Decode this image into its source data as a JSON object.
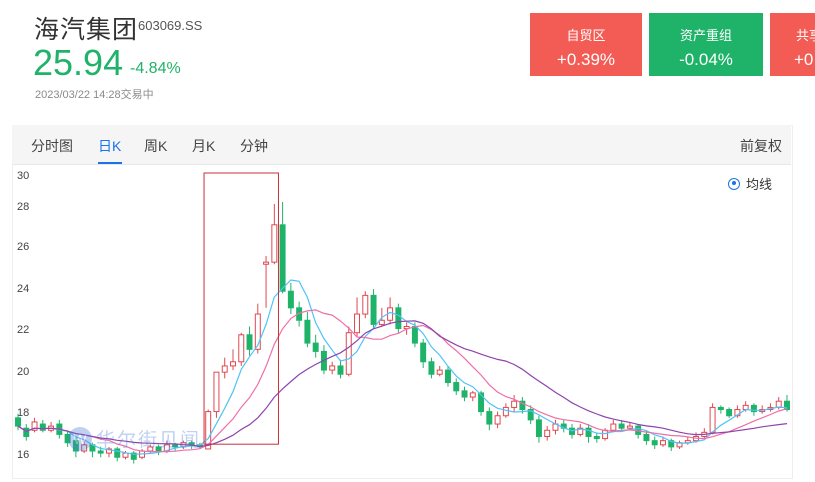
{
  "stock": {
    "name": "海汽集团",
    "code": "603069.SS",
    "price": "25.94",
    "change": "-4.84%",
    "timestamp": "2023/03/22 14:28交易中"
  },
  "sector_cards": [
    {
      "title": "自贸区",
      "value": "+0.39%",
      "color": "#f25c54"
    },
    {
      "title": "资产重组",
      "value": "-0.04%",
      "color": "#1fb36a"
    },
    {
      "title": "共享",
      "value": "+0",
      "color": "#f25c54"
    }
  ],
  "tabs": [
    "分时图",
    "日K",
    "周K",
    "月K",
    "分钟"
  ],
  "active_tab": "日K",
  "adjust_label": "前复权",
  "legend_label": "均线",
  "watermark": "华尔街见闻",
  "colors": {
    "up": "#e0484f",
    "down": "#1fb36a",
    "ma5": "#4fc3f7",
    "ma10": "#ef6fa8",
    "ma20": "#8e44ad"
  },
  "chart_data": {
    "type": "candlestick",
    "y_ticks": [
      "30",
      "28",
      "26",
      "24",
      "22",
      "20",
      "18",
      "16"
    ],
    "ylim": [
      15.6,
      30.2
    ],
    "candles": [
      [
        18.5,
        18.1,
        18.7,
        17.9
      ],
      [
        18.0,
        17.6,
        18.2,
        17.4
      ],
      [
        17.9,
        18.3,
        18.5,
        17.8
      ],
      [
        18.2,
        17.9,
        18.4,
        17.8
      ],
      [
        17.9,
        18.1,
        18.3,
        17.8
      ],
      [
        18.2,
        17.7,
        18.4,
        17.5
      ],
      [
        17.7,
        17.3,
        17.9,
        17.1
      ],
      [
        17.4,
        16.9,
        17.6,
        16.6
      ],
      [
        16.9,
        17.2,
        17.4,
        16.8
      ],
      [
        17.2,
        16.9,
        17.3,
        16.6
      ],
      [
        16.9,
        16.8,
        17.1,
        16.6
      ],
      [
        16.8,
        17.0,
        17.1,
        16.6
      ],
      [
        17.0,
        16.6,
        17.1,
        16.4
      ],
      [
        16.6,
        16.8,
        16.9,
        16.5
      ],
      [
        16.8,
        16.5,
        16.9,
        16.3
      ],
      [
        16.6,
        16.9,
        17.0,
        16.5
      ],
      [
        16.9,
        17.1,
        17.2,
        16.8
      ],
      [
        17.1,
        16.9,
        17.2,
        16.7
      ],
      [
        16.9,
        17.2,
        17.4,
        16.8
      ],
      [
        17.2,
        17.1,
        17.3,
        16.9
      ],
      [
        17.1,
        17.3,
        17.4,
        17.0
      ],
      [
        17.3,
        17.2,
        17.4,
        17.0
      ],
      [
        17.2,
        17.1,
        17.3,
        17.0
      ],
      [
        17.0,
        18.8,
        18.9,
        17.0
      ],
      [
        18.8,
        20.7,
        20.7,
        18.5
      ],
      [
        20.7,
        21.0,
        21.4,
        20.4
      ],
      [
        21.0,
        21.2,
        21.8,
        20.8
      ],
      [
        21.2,
        22.5,
        22.6,
        21.0
      ],
      [
        22.5,
        21.8,
        22.9,
        21.5
      ],
      [
        21.8,
        23.5,
        24.0,
        21.6
      ],
      [
        25.9,
        26.0,
        26.3,
        23.8
      ],
      [
        26.0,
        27.8,
        28.8,
        25.9
      ],
      [
        27.8,
        24.6,
        28.9,
        24.5
      ],
      [
        24.6,
        23.8,
        25.0,
        23.5
      ],
      [
        23.8,
        23.2,
        24.1,
        22.9
      ],
      [
        23.2,
        22.1,
        23.6,
        21.9
      ],
      [
        22.1,
        21.7,
        22.5,
        21.4
      ],
      [
        21.7,
        20.8,
        22.0,
        20.6
      ],
      [
        20.8,
        21.0,
        21.2,
        20.6
      ],
      [
        21.0,
        20.6,
        21.3,
        20.4
      ],
      [
        20.6,
        22.6,
        22.9,
        20.5
      ],
      [
        22.6,
        23.5,
        24.3,
        22.4
      ],
      [
        23.5,
        24.4,
        24.6,
        23.3
      ],
      [
        24.4,
        23.0,
        24.7,
        22.8
      ],
      [
        23.0,
        23.2,
        23.8,
        22.9
      ],
      [
        23.2,
        23.8,
        24.3,
        23.0
      ],
      [
        23.8,
        22.8,
        24.0,
        22.6
      ],
      [
        22.8,
        22.9,
        23.1,
        22.5
      ],
      [
        22.9,
        22.1,
        23.1,
        21.9
      ],
      [
        22.1,
        21.2,
        22.3,
        20.9
      ],
      [
        21.2,
        20.6,
        21.4,
        20.4
      ],
      [
        20.6,
        20.8,
        21.0,
        20.5
      ],
      [
        20.8,
        20.2,
        21.0,
        20.0
      ],
      [
        20.2,
        19.8,
        20.4,
        19.6
      ],
      [
        19.8,
        19.5,
        20.0,
        19.3
      ],
      [
        19.5,
        19.7,
        19.8,
        19.3
      ],
      [
        19.7,
        18.8,
        19.8,
        18.6
      ],
      [
        18.8,
        18.2,
        19.0,
        17.9
      ],
      [
        18.2,
        18.6,
        18.8,
        18.0
      ],
      [
        18.6,
        19.0,
        19.2,
        18.5
      ],
      [
        19.0,
        19.3,
        19.6,
        18.8
      ],
      [
        19.3,
        18.9,
        19.5,
        18.7
      ],
      [
        18.9,
        18.4,
        19.1,
        18.2
      ],
      [
        18.4,
        17.6,
        18.6,
        17.3
      ],
      [
        17.6,
        17.9,
        18.1,
        17.4
      ],
      [
        17.9,
        18.2,
        18.4,
        17.7
      ],
      [
        18.2,
        18.0,
        18.4,
        17.8
      ],
      [
        18.0,
        17.7,
        18.2,
        17.5
      ],
      [
        17.7,
        18.0,
        18.2,
        17.6
      ],
      [
        18.0,
        17.6,
        18.2,
        17.3
      ],
      [
        17.6,
        17.5,
        17.8,
        17.3
      ],
      [
        17.5,
        17.9,
        18.0,
        17.4
      ],
      [
        17.9,
        18.2,
        18.4,
        17.8
      ],
      [
        18.2,
        18.0,
        18.4,
        17.9
      ],
      [
        18.0,
        18.1,
        18.3,
        17.9
      ],
      [
        18.1,
        17.7,
        18.2,
        17.5
      ],
      [
        17.7,
        17.4,
        17.9,
        17.2
      ],
      [
        17.4,
        17.2,
        17.6,
        17.0
      ],
      [
        17.2,
        17.4,
        17.6,
        17.1
      ],
      [
        17.4,
        17.1,
        17.5,
        16.9
      ],
      [
        17.1,
        17.3,
        17.4,
        17.0
      ],
      [
        17.3,
        17.4,
        17.6,
        17.2
      ],
      [
        17.4,
        17.6,
        17.8,
        17.3
      ],
      [
        17.6,
        17.8,
        18.0,
        17.5
      ],
      [
        17.8,
        19.0,
        19.2,
        17.7
      ],
      [
        19.0,
        18.9,
        19.1,
        18.7
      ],
      [
        18.9,
        18.6,
        19.0,
        18.5
      ],
      [
        18.6,
        18.9,
        19.1,
        18.5
      ],
      [
        18.9,
        19.1,
        19.3,
        18.8
      ],
      [
        19.1,
        18.8,
        19.2,
        18.6
      ],
      [
        18.8,
        18.9,
        19.1,
        18.7
      ],
      [
        18.9,
        19.0,
        19.2,
        18.8
      ],
      [
        19.0,
        19.3,
        19.5,
        18.9
      ],
      [
        19.3,
        18.9,
        19.6,
        18.8
      ]
    ],
    "highlight_range": [
      23,
      31
    ]
  }
}
